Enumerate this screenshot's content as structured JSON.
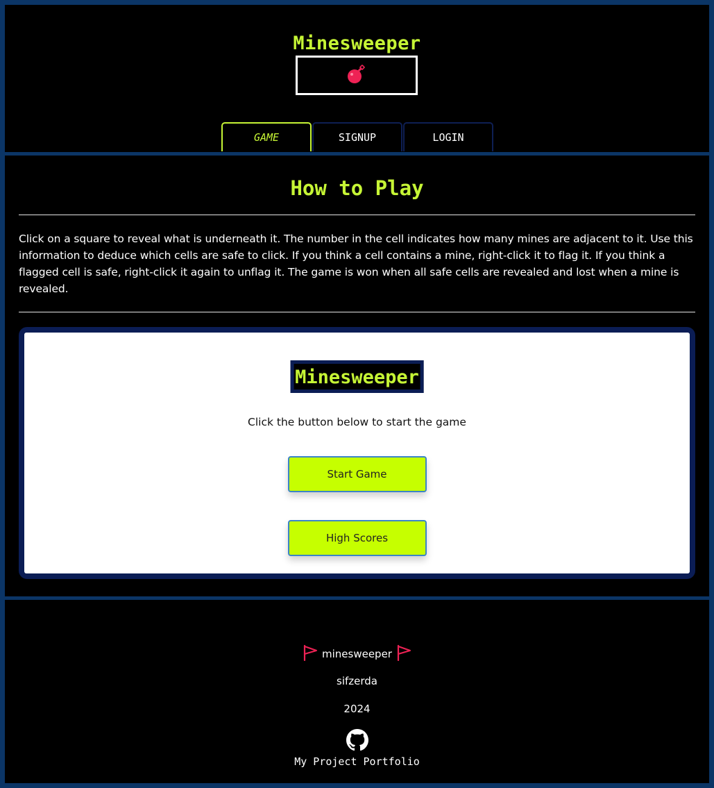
{
  "header": {
    "title": "Minesweeper",
    "bomb_icon": "bomb-icon",
    "tabs": [
      {
        "label": "GAME",
        "active": true
      },
      {
        "label": "SIGNUP",
        "active": false
      },
      {
        "label": "LOGIN",
        "active": false
      }
    ]
  },
  "main": {
    "how_title": "How to Play",
    "instructions": "Click on a square to reveal what is underneath it. The number in the cell indicates how many mines are adjacent to it. Use this information to deduce which cells are safe to click. If you think a cell contains a mine, right-click it to flag it. If you think a flagged cell is safe, right-click it again to unflag it. The game is won when all safe cells are revealed and lost when a mine is revealed.",
    "panel": {
      "logo": "Minesweeper",
      "prompt": "Click the button below to start the game",
      "start_label": "Start Game",
      "scores_label": "High Scores"
    }
  },
  "footer": {
    "brand": "minesweeper",
    "flag_icon": "flag-icon",
    "author": "sifzerda",
    "year": "2024",
    "github_icon": "github-icon",
    "portfolio_label": "My Project Portfolio"
  },
  "colors": {
    "accent": "#c6f535",
    "button": "#c6ff00",
    "frame": "#0b3566",
    "bomb": "#ee2255"
  }
}
